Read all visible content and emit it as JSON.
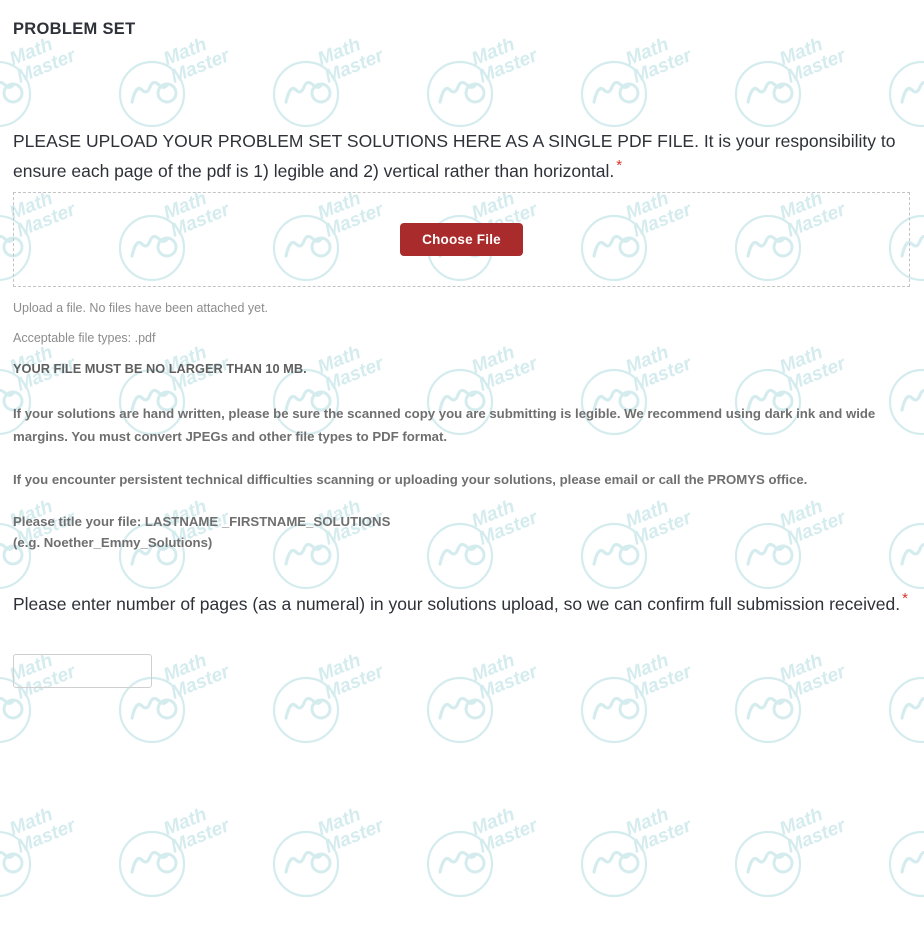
{
  "page": {
    "title": "PROBLEM SET",
    "watermark": {
      "brand_line_1": "Math",
      "brand_line_2": "Master",
      "color": "#d5ecef",
      "monogram_icon": "math-master-circle-monogram-icon"
    },
    "colors": {
      "heading": "#2e3138",
      "body_text": "#6f6f6f",
      "muted_text": "#8c8c8c",
      "required_star": "#d8342b",
      "button_bg": "#aa2b2b",
      "button_text": "#ffffff",
      "dropzone_border": "#c3c3c3",
      "input_border": "#cfcfcf"
    }
  },
  "upload_question": {
    "heading": "PLEASE UPLOAD YOUR PROBLEM SET SOLUTIONS HERE AS A SINGLE PDF FILE. It is your responsibility to ensure each page of the pdf is 1) legible and 2) vertical rather than horizontal.",
    "required_marker": "*",
    "choose_file_label": "Choose File",
    "status_text": "Upload a file. No files have been attached yet.",
    "accepted_types_text": "Acceptable file types: .pdf",
    "size_limit_text": "YOUR FILE MUST BE NO LARGER THAN 10 MB.",
    "paragraphs": [
      "If your solutions are hand written, please be sure the scanned copy you are submitting is legible. We recommend using dark ink and wide margins. You must convert JPEGs and other file types to PDF format.",
      "If you encounter persistent technical difficulties scanning or uploading your solutions, please email or call the PROMYS office."
    ],
    "filename_instruction_line_1": "Please title your file: LASTNAME _FIRSTNAME_SOLUTIONS",
    "filename_instruction_line_2": "(e.g. Noether_Emmy_Solutions)"
  },
  "pages_question": {
    "heading": "Please enter number of pages (as a numeral) in your solutions upload, so we can confirm full submission received.",
    "required_marker": "*",
    "input_value": "",
    "input_placeholder": ""
  }
}
